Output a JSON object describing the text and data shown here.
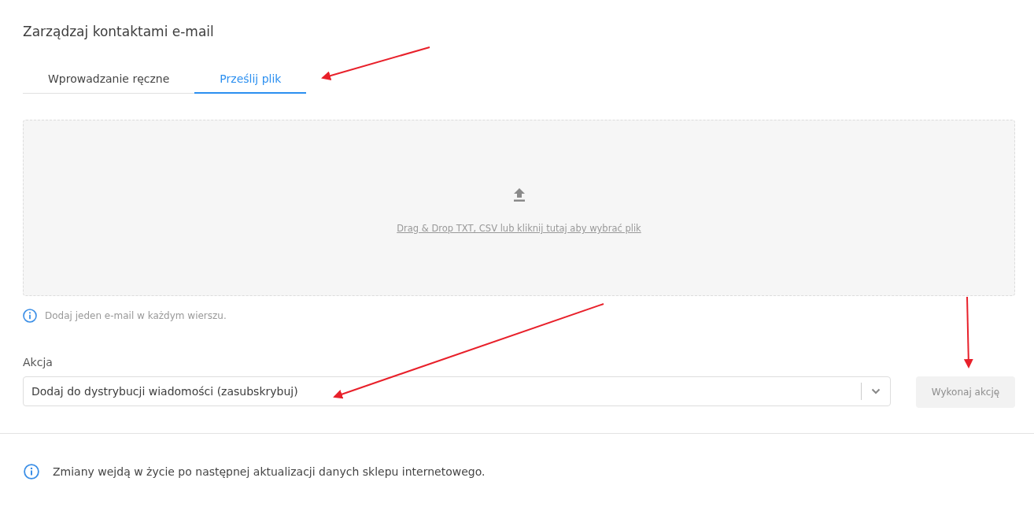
{
  "title": "Zarządzaj kontaktami e-mail",
  "tabs": [
    {
      "label": "Wprowadzanie ręczne",
      "selected": false
    },
    {
      "label": "Prześlij plik",
      "selected": true
    }
  ],
  "dropzone": {
    "link": "Drag & Drop TXT, CSV lub kliknij tutaj aby wybrać plik"
  },
  "hint": "Dodaj jeden e-mail w każdym wierszu.",
  "action": {
    "label": "Akcja",
    "value": "Dodaj do dystrybucji wiadomości (zasubskrybuj)"
  },
  "submit": {
    "label": "Wykonaj akcję",
    "disabled": true
  },
  "footer_note": "Zmiany wejdą w życie po następnej aktualizacji danych sklepu internetowego."
}
